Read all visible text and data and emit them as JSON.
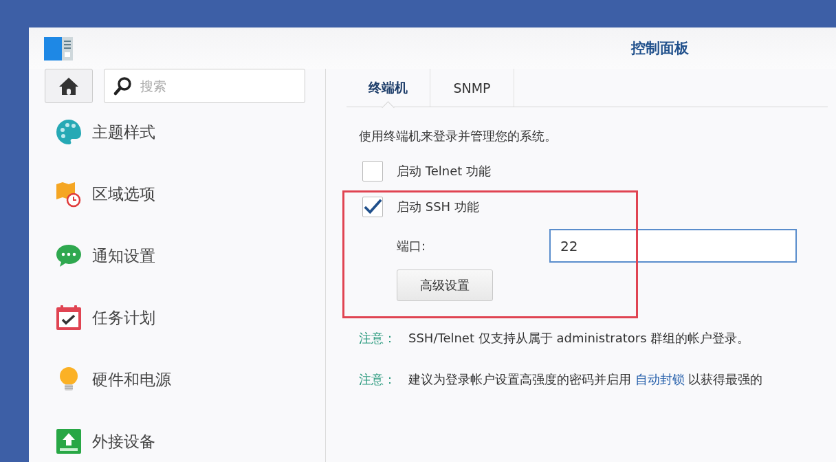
{
  "window": {
    "title": "控制面板"
  },
  "sidebar": {
    "search": {
      "placeholder": "搜索"
    },
    "items": [
      {
        "label": "主题样式"
      },
      {
        "label": "区域选项"
      },
      {
        "label": "通知设置"
      },
      {
        "label": "任务计划"
      },
      {
        "label": "硬件和电源"
      },
      {
        "label": "外接设备"
      }
    ]
  },
  "tabs": [
    {
      "label": "终端机",
      "selected": true
    },
    {
      "label": "SNMP",
      "selected": false
    }
  ],
  "description": "使用终端机来登录并管理您的系统。",
  "options": [
    {
      "label": "启动 Telnet 功能",
      "checked": false
    },
    {
      "label": "启动 SSH 功能",
      "checked": true
    }
  ],
  "port": {
    "label": "端口:",
    "value": "22"
  },
  "advanced_button": "高级设置",
  "notes": [
    {
      "label": "注意：",
      "text": "SSH/Telnet 仅支持从属于 administrators 群组的帐户登录。"
    },
    {
      "label": "注意：",
      "text": "建议为登录帐户设置高强度的密码并启用 ",
      "link": "自动封锁",
      "after": " 以获得最强的"
    }
  ]
}
